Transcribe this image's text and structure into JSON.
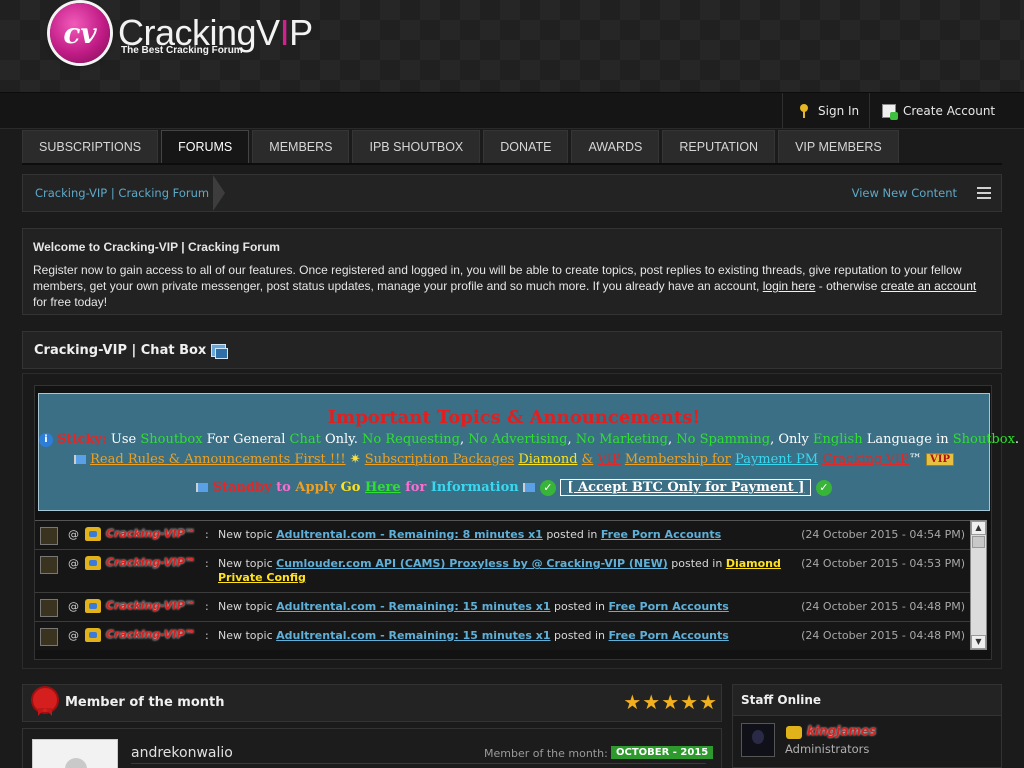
{
  "header": {
    "logo_mark": "cv",
    "logo_text_main": "CrackingV",
    "logo_text_i": "I",
    "logo_text_end": "P",
    "tagline": "The Best Cracking Forum"
  },
  "userbar": {
    "sign_in": "Sign In",
    "create_account": "Create Account"
  },
  "nav": {
    "tabs": [
      {
        "label": "Subscriptions",
        "active": false
      },
      {
        "label": "Forums",
        "active": true
      },
      {
        "label": "Members",
        "active": false
      },
      {
        "label": "IPB Shoutbox",
        "active": false
      },
      {
        "label": "Donate",
        "active": false
      },
      {
        "label": "Awards",
        "active": false
      },
      {
        "label": "Reputation",
        "active": false
      },
      {
        "label": "VIP Members",
        "active": false
      }
    ]
  },
  "breadcrumb": {
    "home": "Cracking-VIP | Cracking Forum",
    "view_new": "View New Content"
  },
  "welcome": {
    "title": "Welcome to Cracking-VIP | Cracking Forum",
    "body_1": "Register now to gain access to all of our features. Once registered and logged in, you will be able to create topics, post replies to existing threads, give reputation to your fellow members, get your own private messenger, post status updates, manage your profile and so much more. If you already have an account, ",
    "login_link": "login here",
    "body_2": " - otherwise ",
    "create_link": "create an account",
    "body_3": " for free today!"
  },
  "chatbox": {
    "title": "Cracking-VIP | Chat Box"
  },
  "announcement": {
    "title": "Important Topics & Announcements!",
    "l1": {
      "sticky": "Sticky:",
      "use": " Use ",
      "shoutbox": "Shoutbox",
      "for_general": " For General ",
      "chat": "Chat",
      "only": " Only. ",
      "no_req": "No Requesting",
      "comma1": ", ",
      "no_adv": "No Advertising",
      "comma2": ", ",
      "no_mkt": "No Marketing",
      "comma3": ", ",
      "no_spam": "No Spamming",
      "only_txt": ", Only ",
      "english": "English",
      "language_in": " Language in ",
      "shoutbox2": "Shoutbox",
      "dot": "."
    },
    "l2": {
      "read_rules": "Read Rules & Announcements First !!!",
      "sub_pkgs": "Subscription Packages",
      "diamond": "Diamond",
      "amp": "&",
      "vip": "VIP",
      "membership_for": "Membership for",
      "payment_pm": "Payment PM",
      "cvip": "Cracking-VIP",
      "tm": "™",
      "vip_badge": "VIP"
    },
    "l3": {
      "standby": "Standby",
      "to": " to ",
      "apply": "Apply",
      "go": " Go ",
      "here": "Here",
      "for": " for ",
      "information": "Information",
      "btc": "[ Accept BTC Only for Payment ]"
    }
  },
  "shoutbox": {
    "rows": [
      {
        "user": "Cracking-VIP™",
        "prefix": "New topic ",
        "topic": "Adultrental.com - Remaining: 8 minutes x1",
        "mid": " posted in ",
        "forum": "Free Porn Accounts",
        "forum_yellow": false,
        "time": "(24 October 2015 - 04:54 PM)"
      },
      {
        "user": "Cracking-VIP™",
        "prefix": "New topic ",
        "topic": "Cumlouder.com API (CAMS) Proxyless by @ Cracking-VIP (NEW)",
        "mid": " posted in ",
        "forum": "Diamond Private Config",
        "forum_yellow": true,
        "time": "(24 October 2015 - 04:53 PM)"
      },
      {
        "user": "Cracking-VIP™",
        "prefix": "New topic ",
        "topic": "Adultrental.com - Remaining: 15 minutes x1",
        "mid": " posted in ",
        "forum": "Free Porn Accounts",
        "forum_yellow": false,
        "time": "(24 October 2015 - 04:48 PM)"
      },
      {
        "user": "Cracking-VIP™",
        "prefix": "New topic ",
        "topic": "Adultrental.com - Remaining: 15 minutes x1",
        "mid": " posted in ",
        "forum": "Free Porn Accounts",
        "forum_yellow": false,
        "time": "(24 October 2015 - 04:48 PM)"
      }
    ]
  },
  "member_of_month": {
    "title": "Member of the month",
    "stars": 5,
    "username": "andrekonwalio",
    "label": "Member of the month:",
    "badge": "OCTOBER - 2015"
  },
  "staff": {
    "title": "Staff Online",
    "name": "kingjames",
    "role": "Administrators"
  },
  "colors": {
    "accent_link": "#5fa8c7",
    "brand_pink": "#c11c86",
    "announce_bg": "#3a6f85"
  }
}
